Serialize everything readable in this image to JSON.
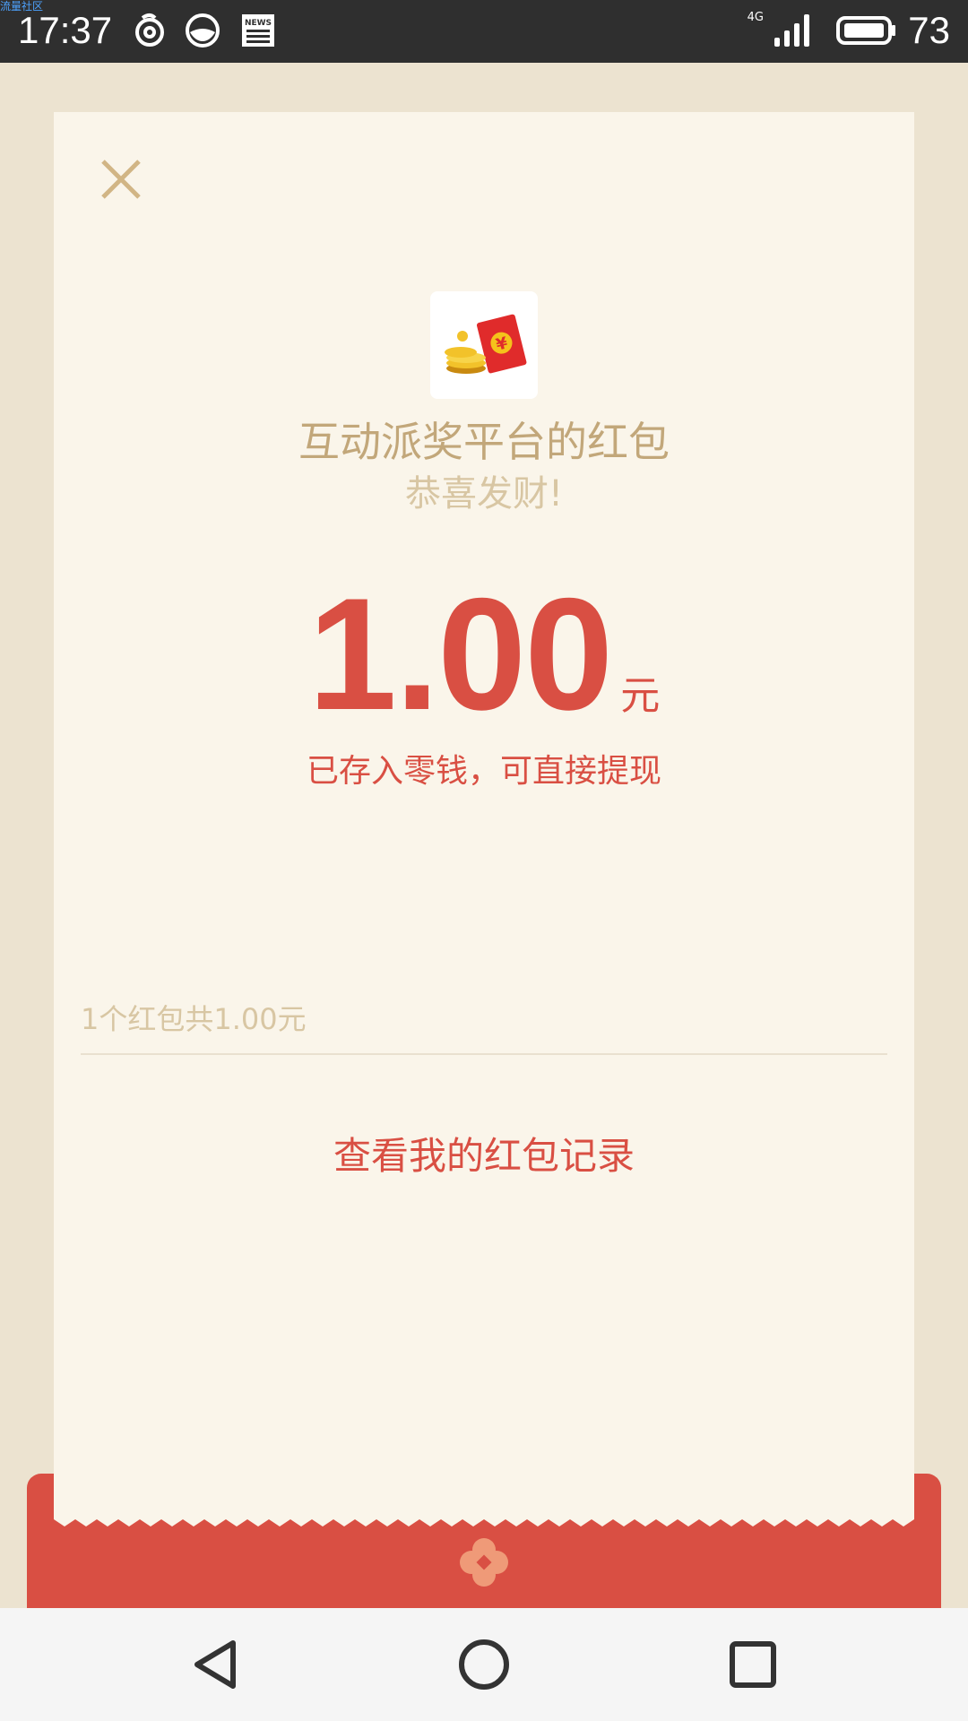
{
  "status_bar": {
    "watermark": "流量社区",
    "time": "17:37",
    "network_type": "4G",
    "battery_percent": "73",
    "icons": [
      "netease-cloud-music-icon",
      "browser-icon",
      "news-icon",
      "signal-icon",
      "battery-icon"
    ]
  },
  "redpacket": {
    "sender": "互动派奖平台的红包",
    "greeting": "恭喜发财!",
    "amount": "1.00",
    "unit": "元",
    "deposit_note": "已存入零钱，可直接提现",
    "summary": "1个红包共1.00元",
    "records_link": "查看我的红包记录",
    "app_icon": "red-envelope-coins-icon"
  },
  "colors": {
    "accent_red": "#d94f43",
    "gold_text": "#c2a77a",
    "light_gold_text": "#d8c6a3",
    "card_bg": "#faf5ea",
    "page_bg": "#ece3d0"
  },
  "nav_bar": {
    "icons": [
      "back-icon",
      "home-icon",
      "recents-icon"
    ]
  }
}
